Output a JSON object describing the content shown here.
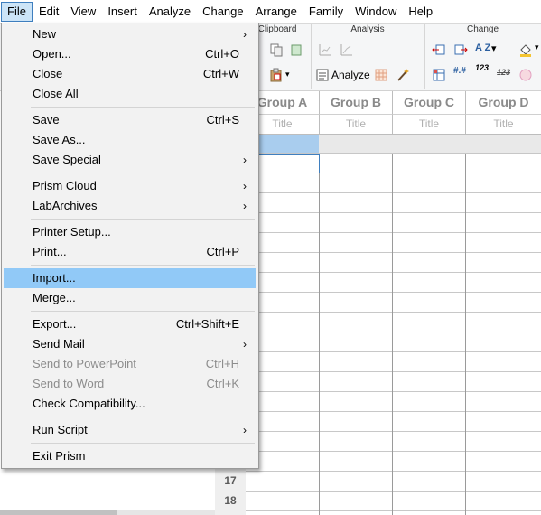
{
  "menubar": {
    "items": [
      "File",
      "Edit",
      "View",
      "Insert",
      "Analyze",
      "Change",
      "Arrange",
      "Family",
      "Window",
      "Help"
    ]
  },
  "ribbon": {
    "clipboard_title": "Clipboard",
    "analysis_title": "Analysis",
    "change_title": "Change",
    "analyze_label": "Analyze",
    "sort_az": "A Z",
    "num_123": "123",
    "num_123_strike": "123"
  },
  "sheet": {
    "columns": [
      {
        "header": "Group A",
        "title": "Title"
      },
      {
        "header": "Group B",
        "title": "Title"
      },
      {
        "header": "Group C",
        "title": "Title"
      },
      {
        "header": "Group D",
        "title": "Title"
      }
    ],
    "row_numbers": [
      "17",
      "18"
    ]
  },
  "file_menu": {
    "items": [
      {
        "label": "New",
        "shortcut": "",
        "submenu": true,
        "disabled": false
      },
      {
        "label": "Open...",
        "shortcut": "Ctrl+O",
        "submenu": false,
        "disabled": false
      },
      {
        "label": "Close",
        "shortcut": "Ctrl+W",
        "submenu": false,
        "disabled": false
      },
      {
        "label": "Close All",
        "shortcut": "",
        "submenu": false,
        "disabled": false
      },
      {
        "label": "Save",
        "shortcut": "Ctrl+S",
        "submenu": false,
        "disabled": false
      },
      {
        "label": "Save As...",
        "shortcut": "",
        "submenu": false,
        "disabled": false
      },
      {
        "label": "Save Special",
        "shortcut": "",
        "submenu": true,
        "disabled": false
      },
      {
        "label": "Prism Cloud",
        "shortcut": "",
        "submenu": true,
        "disabled": false
      },
      {
        "label": "LabArchives",
        "shortcut": "",
        "submenu": true,
        "disabled": false
      },
      {
        "label": "Printer Setup...",
        "shortcut": "",
        "submenu": false,
        "disabled": false
      },
      {
        "label": "Print...",
        "shortcut": "Ctrl+P",
        "submenu": false,
        "disabled": false
      },
      {
        "label": "Import...",
        "shortcut": "",
        "submenu": false,
        "disabled": false,
        "highlighted": true
      },
      {
        "label": "Merge...",
        "shortcut": "",
        "submenu": false,
        "disabled": false
      },
      {
        "label": "Export...",
        "shortcut": "Ctrl+Shift+E",
        "submenu": false,
        "disabled": false
      },
      {
        "label": "Send Mail",
        "shortcut": "",
        "submenu": true,
        "disabled": false
      },
      {
        "label": "Send to PowerPoint",
        "shortcut": "Ctrl+H",
        "submenu": false,
        "disabled": true
      },
      {
        "label": "Send to Word",
        "shortcut": "Ctrl+K",
        "submenu": false,
        "disabled": true
      },
      {
        "label": "Check Compatibility...",
        "shortcut": "",
        "submenu": false,
        "disabled": false
      },
      {
        "label": "Run Script",
        "shortcut": "",
        "submenu": true,
        "disabled": false
      },
      {
        "label": "Exit Prism",
        "shortcut": "",
        "submenu": false,
        "disabled": false
      }
    ],
    "submenu_glyph": "›"
  },
  "colors": {
    "highlight": "#91c9f7",
    "menu_bg": "#f2f2f2",
    "selected_row": "#a9cdee"
  }
}
